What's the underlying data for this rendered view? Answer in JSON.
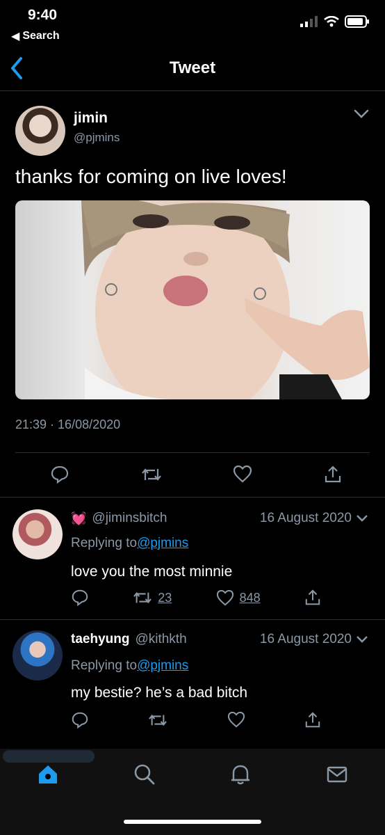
{
  "status_bar": {
    "time": "9:40",
    "back_label": "Search"
  },
  "nav": {
    "title": "Tweet"
  },
  "tweet": {
    "name": "jimin",
    "handle": "@pjmins",
    "text": "thanks for coming on live loves!",
    "timestamp": "21:39 · 16/08/2020"
  },
  "replies": [
    {
      "name": "",
      "emoji": "💓",
      "handle": "@jiminsbitch",
      "date": "16 August 2020",
      "replying_prefix": "Replying to",
      "replying_handle": "@pjmins",
      "text": "love you the most minnie",
      "retweets": "23",
      "likes": "848"
    },
    {
      "name": "taehyung",
      "emoji": "",
      "handle": "@kithkth",
      "date": "16 August 2020",
      "replying_prefix": "Replying to",
      "replying_handle": "@pjmins",
      "text": "my bestie? he’s a bad bitch",
      "retweets": "",
      "likes": ""
    }
  ],
  "colors": {
    "accent": "#1d9bf0",
    "secondary_text": "#8b98a5",
    "divider": "#2a2f33",
    "background": "#000000"
  },
  "icons": {
    "tabbar": [
      "home-icon",
      "search-icon",
      "bell-icon",
      "mail-icon"
    ],
    "actions": [
      "reply-icon",
      "retweet-icon",
      "like-icon",
      "share-icon"
    ]
  }
}
